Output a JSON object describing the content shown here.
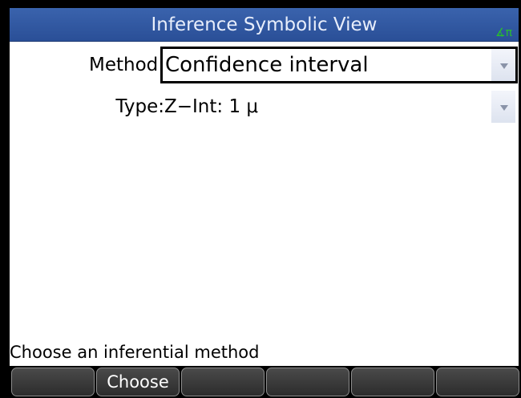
{
  "title_bar": {
    "title": "Inference Symbolic View",
    "angle_indicator": "∡π"
  },
  "form": {
    "method": {
      "label": "Method:",
      "value": "Confidence interval"
    },
    "type": {
      "label": "Type:",
      "value": "Z−Int: 1 μ"
    }
  },
  "status": {
    "text": "Choose an inferential method"
  },
  "softkeys": [
    "",
    "Choose",
    "",
    "",
    "",
    ""
  ],
  "colors": {
    "title_bar": "#2a4f97",
    "title_text": "#e8eefb",
    "angle_indicator": "#27c02b",
    "softkey_bg": "#2c2c2c"
  }
}
